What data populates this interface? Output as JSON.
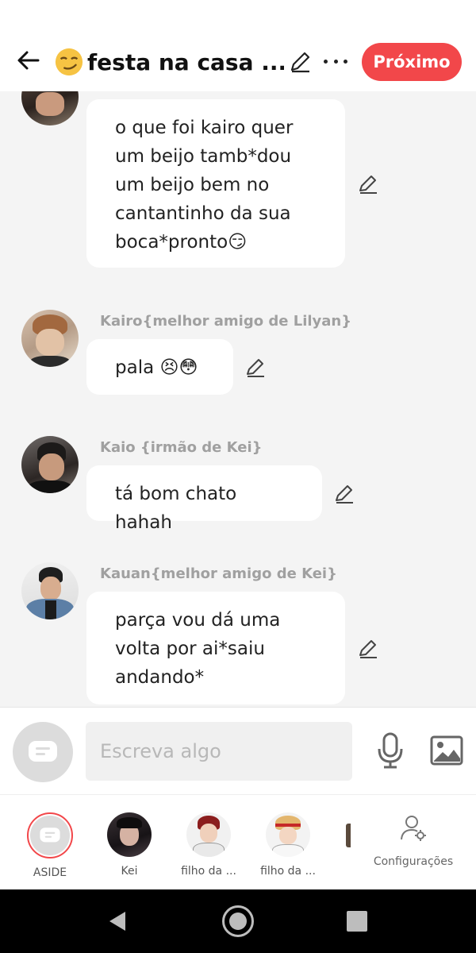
{
  "header": {
    "title": "festa na casa ...",
    "next_label": "Próximo"
  },
  "messages": [
    {
      "sender": "",
      "text": "o que foi kairo quer\num beijo tamb*dou\num beijo bem no\ncantantinho da sua\nboca*pronto😏"
    },
    {
      "sender": "Kairo{melhor amigo de Lilyan}",
      "text": "pala 😣😳"
    },
    {
      "sender": "Kaio {irmão de Kei}",
      "text": "tá bom chato hahah"
    },
    {
      "sender": "Kauan{melhor amigo de Kei}",
      "text": "parça vou dá uma\nvolta por ai*saiu\nandando*"
    }
  ],
  "input": {
    "placeholder": "Escreva algo"
  },
  "characters": [
    {
      "label": "ASIDE"
    },
    {
      "label": "Kei"
    },
    {
      "label": "filho da ..."
    },
    {
      "label": "filho da ..."
    }
  ],
  "settings_label": "Configurações",
  "colors": {
    "accent": "#f2474a",
    "background": "#f4f4f4",
    "bubble": "#ffffff",
    "sender": "#a0a0a0"
  },
  "icons": [
    "back-arrow-icon",
    "smirk-emoji-icon",
    "edit-pencil-icon",
    "more-dots-icon",
    "chat-bubble-icon",
    "microphone-icon",
    "image-icon",
    "settings-person-icon"
  ]
}
